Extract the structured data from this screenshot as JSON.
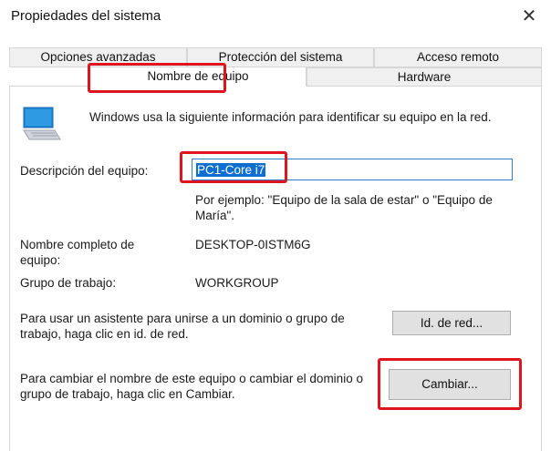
{
  "window": {
    "title": "Propiedades del sistema",
    "close_glyph": "✕"
  },
  "tabs": {
    "row1": [
      "Opciones avanzadas",
      "Protección del sistema",
      "Acceso remoto"
    ],
    "row2": [
      "Nombre de equipo",
      "Hardware"
    ],
    "selected": "Nombre de equipo"
  },
  "info": {
    "icon": "computer-icon",
    "text": "Windows usa la siguiente información para identificar su equipo en la red."
  },
  "description": {
    "label": "Descripción del equipo:",
    "value": "PC1-Core i7",
    "example": "Por ejemplo: \"Equipo de la sala de estar\" o \"Equipo de María\"."
  },
  "full_name": {
    "label": "Nombre completo de equipo:",
    "value": "DESKTOP-0ISTM6G"
  },
  "workgroup": {
    "label": "Grupo de trabajo:",
    "value": "WORKGROUP"
  },
  "network_id": {
    "text": "Para usar un asistente para unirse a un dominio o grupo de trabajo, haga clic en id. de red.",
    "button": "Id. de red..."
  },
  "change": {
    "text": "Para cambiar el nombre de este equipo o cambiar el dominio o grupo de trabajo, haga clic en Cambiar.",
    "button": "Cambiar..."
  },
  "colors": {
    "highlight": "#e0141e",
    "selection": "#0f6fcf",
    "input_border": "#2f7dd6"
  }
}
